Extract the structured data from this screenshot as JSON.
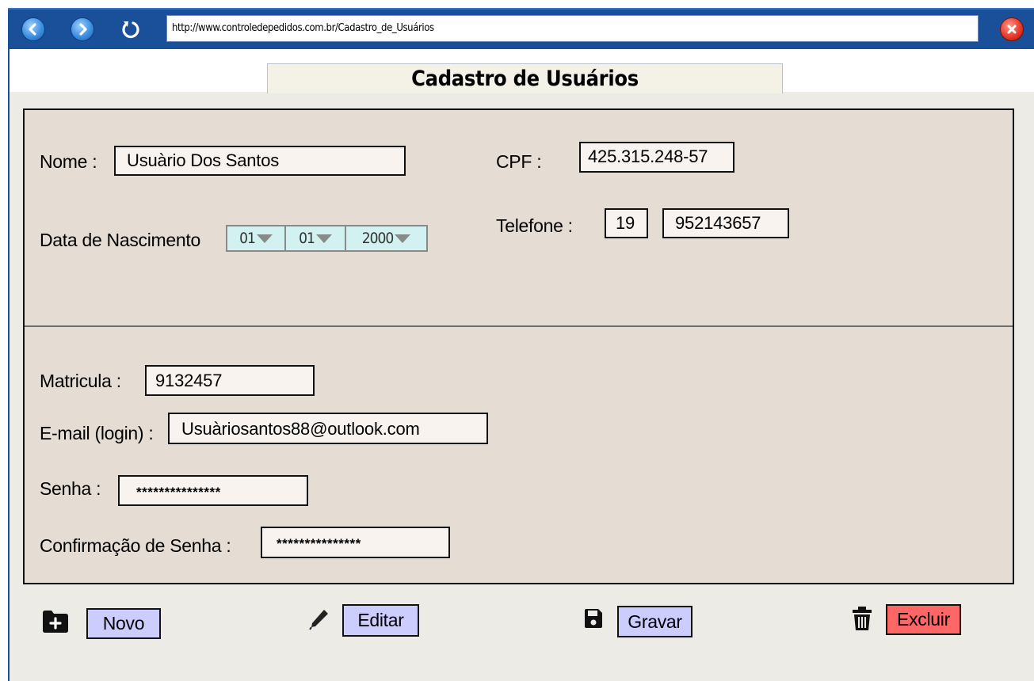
{
  "browser": {
    "url": "http://www.controledepedidos.com.br/Cadastro_de_Usuários",
    "icons": {
      "back": "back-arrow-icon",
      "forward": "forward-arrow-icon",
      "reload": "reload-icon",
      "close": "close-icon"
    }
  },
  "page": {
    "title": "Cadastro de Usuários"
  },
  "form": {
    "nome": {
      "label": "Nome :",
      "value": "Usuàrio Dos Santos"
    },
    "cpf": {
      "label": "CPF :",
      "value": "425.315.248-57"
    },
    "nascimento": {
      "label": "Data de Nascimento",
      "day": "01",
      "month": "01",
      "year": "2000"
    },
    "telefone": {
      "label": "Telefone :",
      "ddd": "19",
      "number": "952143657"
    },
    "matricula": {
      "label": "Matricula :",
      "value": "9132457"
    },
    "email": {
      "label": "E-mail (login) :",
      "value": "Usuàriosantos88@outlook.com"
    },
    "senha": {
      "label": "Senha :",
      "value": "***************"
    },
    "confirmacao": {
      "label": "Confirmação de Senha :",
      "value": "***************"
    }
  },
  "actions": {
    "novo": {
      "label": "Novo",
      "icon": "folder-plus-icon"
    },
    "editar": {
      "label": "Editar",
      "icon": "pencil-icon"
    },
    "gravar": {
      "label": "Gravar",
      "icon": "floppy-disk-icon"
    },
    "excluir": {
      "label": "Excluir",
      "icon": "trash-icon"
    }
  },
  "colors": {
    "browser_bar": "#1a4f99",
    "form_panel": "#e5dcd4",
    "button": "#ccccff",
    "delete_button": "#ff6666",
    "date_select": "#d2f2f2"
  }
}
